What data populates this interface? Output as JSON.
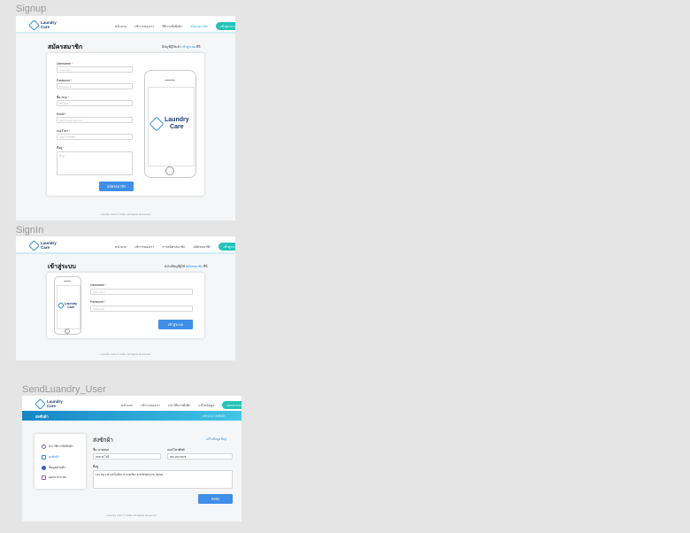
{
  "frames": {
    "signup": "Signup",
    "signin": "SignIn",
    "send": "SendLuandry_User"
  },
  "brand": {
    "line1": "Laundry",
    "line2": "Care"
  },
  "colors": {
    "accent": "#25c3b8",
    "primary": "#3f8ee8",
    "hero_start": "#1585c5",
    "hero_end": "#43c6e6"
  },
  "signup": {
    "nav": [
      "หน้าแรก",
      "บริการของเรา",
      "วิธีการสั่งซักผ้า",
      "สมัครสมาชิก"
    ],
    "nav_button": "เข้าสู่ระบบ",
    "title": "สมัครสมาชิก",
    "aside_text": "มีบัญชีผู้ใช้แล้ว",
    "aside_link": "เข้าสู่ระบบ",
    "aside_suffix": "ที่นี่",
    "fields": [
      {
        "label": "Username",
        "placeholder": "Username"
      },
      {
        "label": "Password",
        "placeholder": "Password"
      },
      {
        "label": "ชื่อ-สกุล",
        "placeholder": "ชื่อ-สกุล"
      },
      {
        "label": "Email",
        "placeholder": "example@mail.com"
      },
      {
        "label": "เบอร์โทร",
        "placeholder": "เบอร์โทรศัพท์"
      },
      {
        "label": "ที่อยู่",
        "placeholder": "ที่อยู่"
      }
    ],
    "submit": "สมัครสมาชิก",
    "footer": "Laundry Care © 2020. All Rights Reserved."
  },
  "signin": {
    "nav": [
      "หน้าแรก",
      "บริการของเรา",
      "การสมัครสมาชิก",
      "สมัครสมาชิก"
    ],
    "nav_button": "เข้าสู่ระบบ",
    "title": "เข้าสู่ระบบ",
    "aside_text": "ยังไม่มีบัญชีผู้ใช้",
    "aside_link": "สมัครสมาชิก",
    "aside_suffix": "ที่นี่",
    "fields": [
      {
        "label": "Username",
        "placeholder": "Username"
      },
      {
        "label": "Password",
        "placeholder": "Password"
      }
    ],
    "submit": "เข้าสู่ระบบ",
    "footer": "Laundry Care © 2020. All Rights Reserved."
  },
  "send": {
    "nav": [
      "หน้าแรก",
      "บริการของเรา",
      "ประวัติการสั่งซัก",
      "แก้ไขข้อมูล"
    ],
    "nav_button": "ออกจากระบบ",
    "hero_title": "ส่งซักผ้า",
    "breadcrumb": "หน้าแรก / ส่งซักผ้า",
    "sidebar": [
      {
        "label": "ประวัติการสั่งซักผ้า",
        "icon": "history-icon"
      },
      {
        "label": "ส่งซักผ้า",
        "icon": "shirt-icon"
      },
      {
        "label": "ข้อมูลส่วนตัว",
        "icon": "user-icon"
      },
      {
        "label": "ออกจากระบบ",
        "icon": "logout-icon"
      }
    ],
    "form_title": "ส่งซักผ้า",
    "form_link": "แก้ไขข้อมูล ที่อยู่",
    "name_label": "ชื่อ-นามสกุล",
    "name_value": "สมชาย ใจดี",
    "phone_label": "เบอร์โทรศัพท์",
    "phone_value": "081 234 5678",
    "address_label": "ที่อยู่",
    "address_value": "123 หมู่ 4 ตำบลในเมือง อำเภอเมือง จังหวัดขอนแก่น 40000",
    "submit": "ส่งซัก",
    "footer": "Laundry Care © 2020. All Rights Reserved."
  }
}
